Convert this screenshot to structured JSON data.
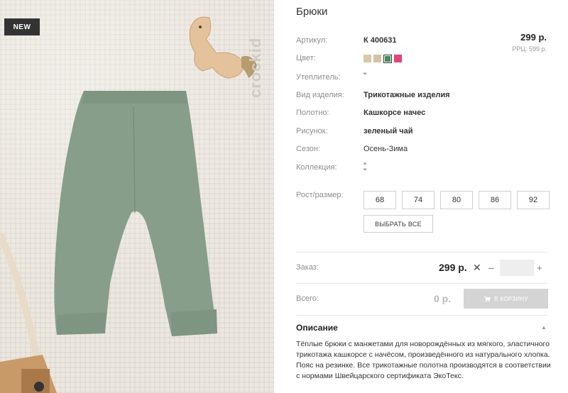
{
  "product": {
    "title": "Брюки",
    "badge": "NEW",
    "watermark": "crockid",
    "price": "299 р.",
    "rrp": "РРЦ: 599 р."
  },
  "attributes": [
    {
      "label": "Артикул:",
      "value": "К 400631",
      "bold": true
    },
    {
      "label": "Цвет:",
      "value": ""
    },
    {
      "label": "Утеплитель:",
      "value": "\""
    },
    {
      "label": "Вид изделия:",
      "value": "Трикотажные изделия",
      "bold": true
    },
    {
      "label": "Полотно:",
      "value": "Кашкорсе начес",
      "bold": true
    },
    {
      "label": "Рисунок:",
      "value": "зеленый чай",
      "bold": true
    },
    {
      "label": "Сезон:",
      "value": "Осень-Зима"
    },
    {
      "label": "Коллекция:",
      "value": "\""
    }
  ],
  "collection_extra": "\"",
  "swatches": [
    {
      "color": "#d9c7a7",
      "selected": false
    },
    {
      "color": "#d3c2a4",
      "selected": false
    },
    {
      "color": "#3f8f5a",
      "selected": true
    },
    {
      "color": "#e0457b",
      "selected": false
    }
  ],
  "sizes": {
    "label": "Рост/размер:",
    "options": [
      "68",
      "74",
      "80",
      "86",
      "92"
    ],
    "select_all": "ВЫБРАТЬ ВСЕ"
  },
  "order": {
    "label": "Заказ:",
    "price": "299 р.",
    "times": "✕",
    "minus": "–",
    "plus": "+",
    "qty": ""
  },
  "total": {
    "label": "Всего:",
    "value": "0 р.",
    "cart_button": "В КОРЗИНУ"
  },
  "description": {
    "title": "Описание",
    "toggle": "▲",
    "text": "Тёплые брюки с манжетами для новорождённых из мягкого, эластичного трикотажа кашкорсе с начёсом, произведённого из натурального хлопка. Пояс на резинке. Все трикотажные полотна производятся в соответствии с нормами Швейцарского сертификата ЭкоТекс."
  },
  "colors": {
    "pants": "#879e8a",
    "background": "#ece7df",
    "badge": "#333333",
    "cart_disabled": "#d4d4d4"
  },
  "icons": [
    "cart-icon",
    "horse-toy-icon"
  ]
}
